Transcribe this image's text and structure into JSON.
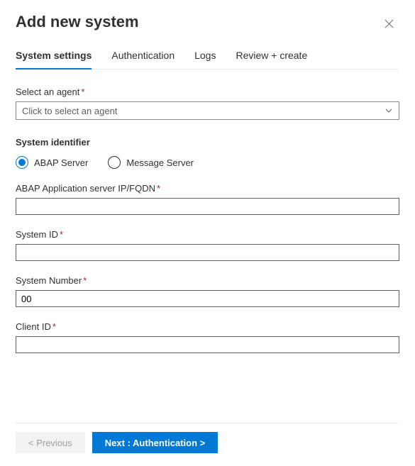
{
  "header": {
    "title": "Add new system"
  },
  "tabs": [
    {
      "label": "System settings",
      "active": true
    },
    {
      "label": "Authentication",
      "active": false
    },
    {
      "label": "Logs",
      "active": false
    },
    {
      "label": "Review + create",
      "active": false
    }
  ],
  "agent": {
    "label": "Select an agent",
    "placeholder": "Click to select an agent"
  },
  "systemIdentifier": {
    "heading": "System identifier",
    "options": {
      "abap": "ABAP Server",
      "message": "Message Server"
    },
    "selected": "abap"
  },
  "fields": {
    "abapServer": {
      "label": "ABAP Application server IP/FQDN",
      "value": ""
    },
    "systemId": {
      "label": "System ID",
      "value": ""
    },
    "systemNumber": {
      "label": "System Number",
      "value": "00"
    },
    "clientId": {
      "label": "Client ID",
      "value": ""
    }
  },
  "footer": {
    "previous": "< Previous",
    "next": "Next : Authentication >"
  },
  "req": "*"
}
